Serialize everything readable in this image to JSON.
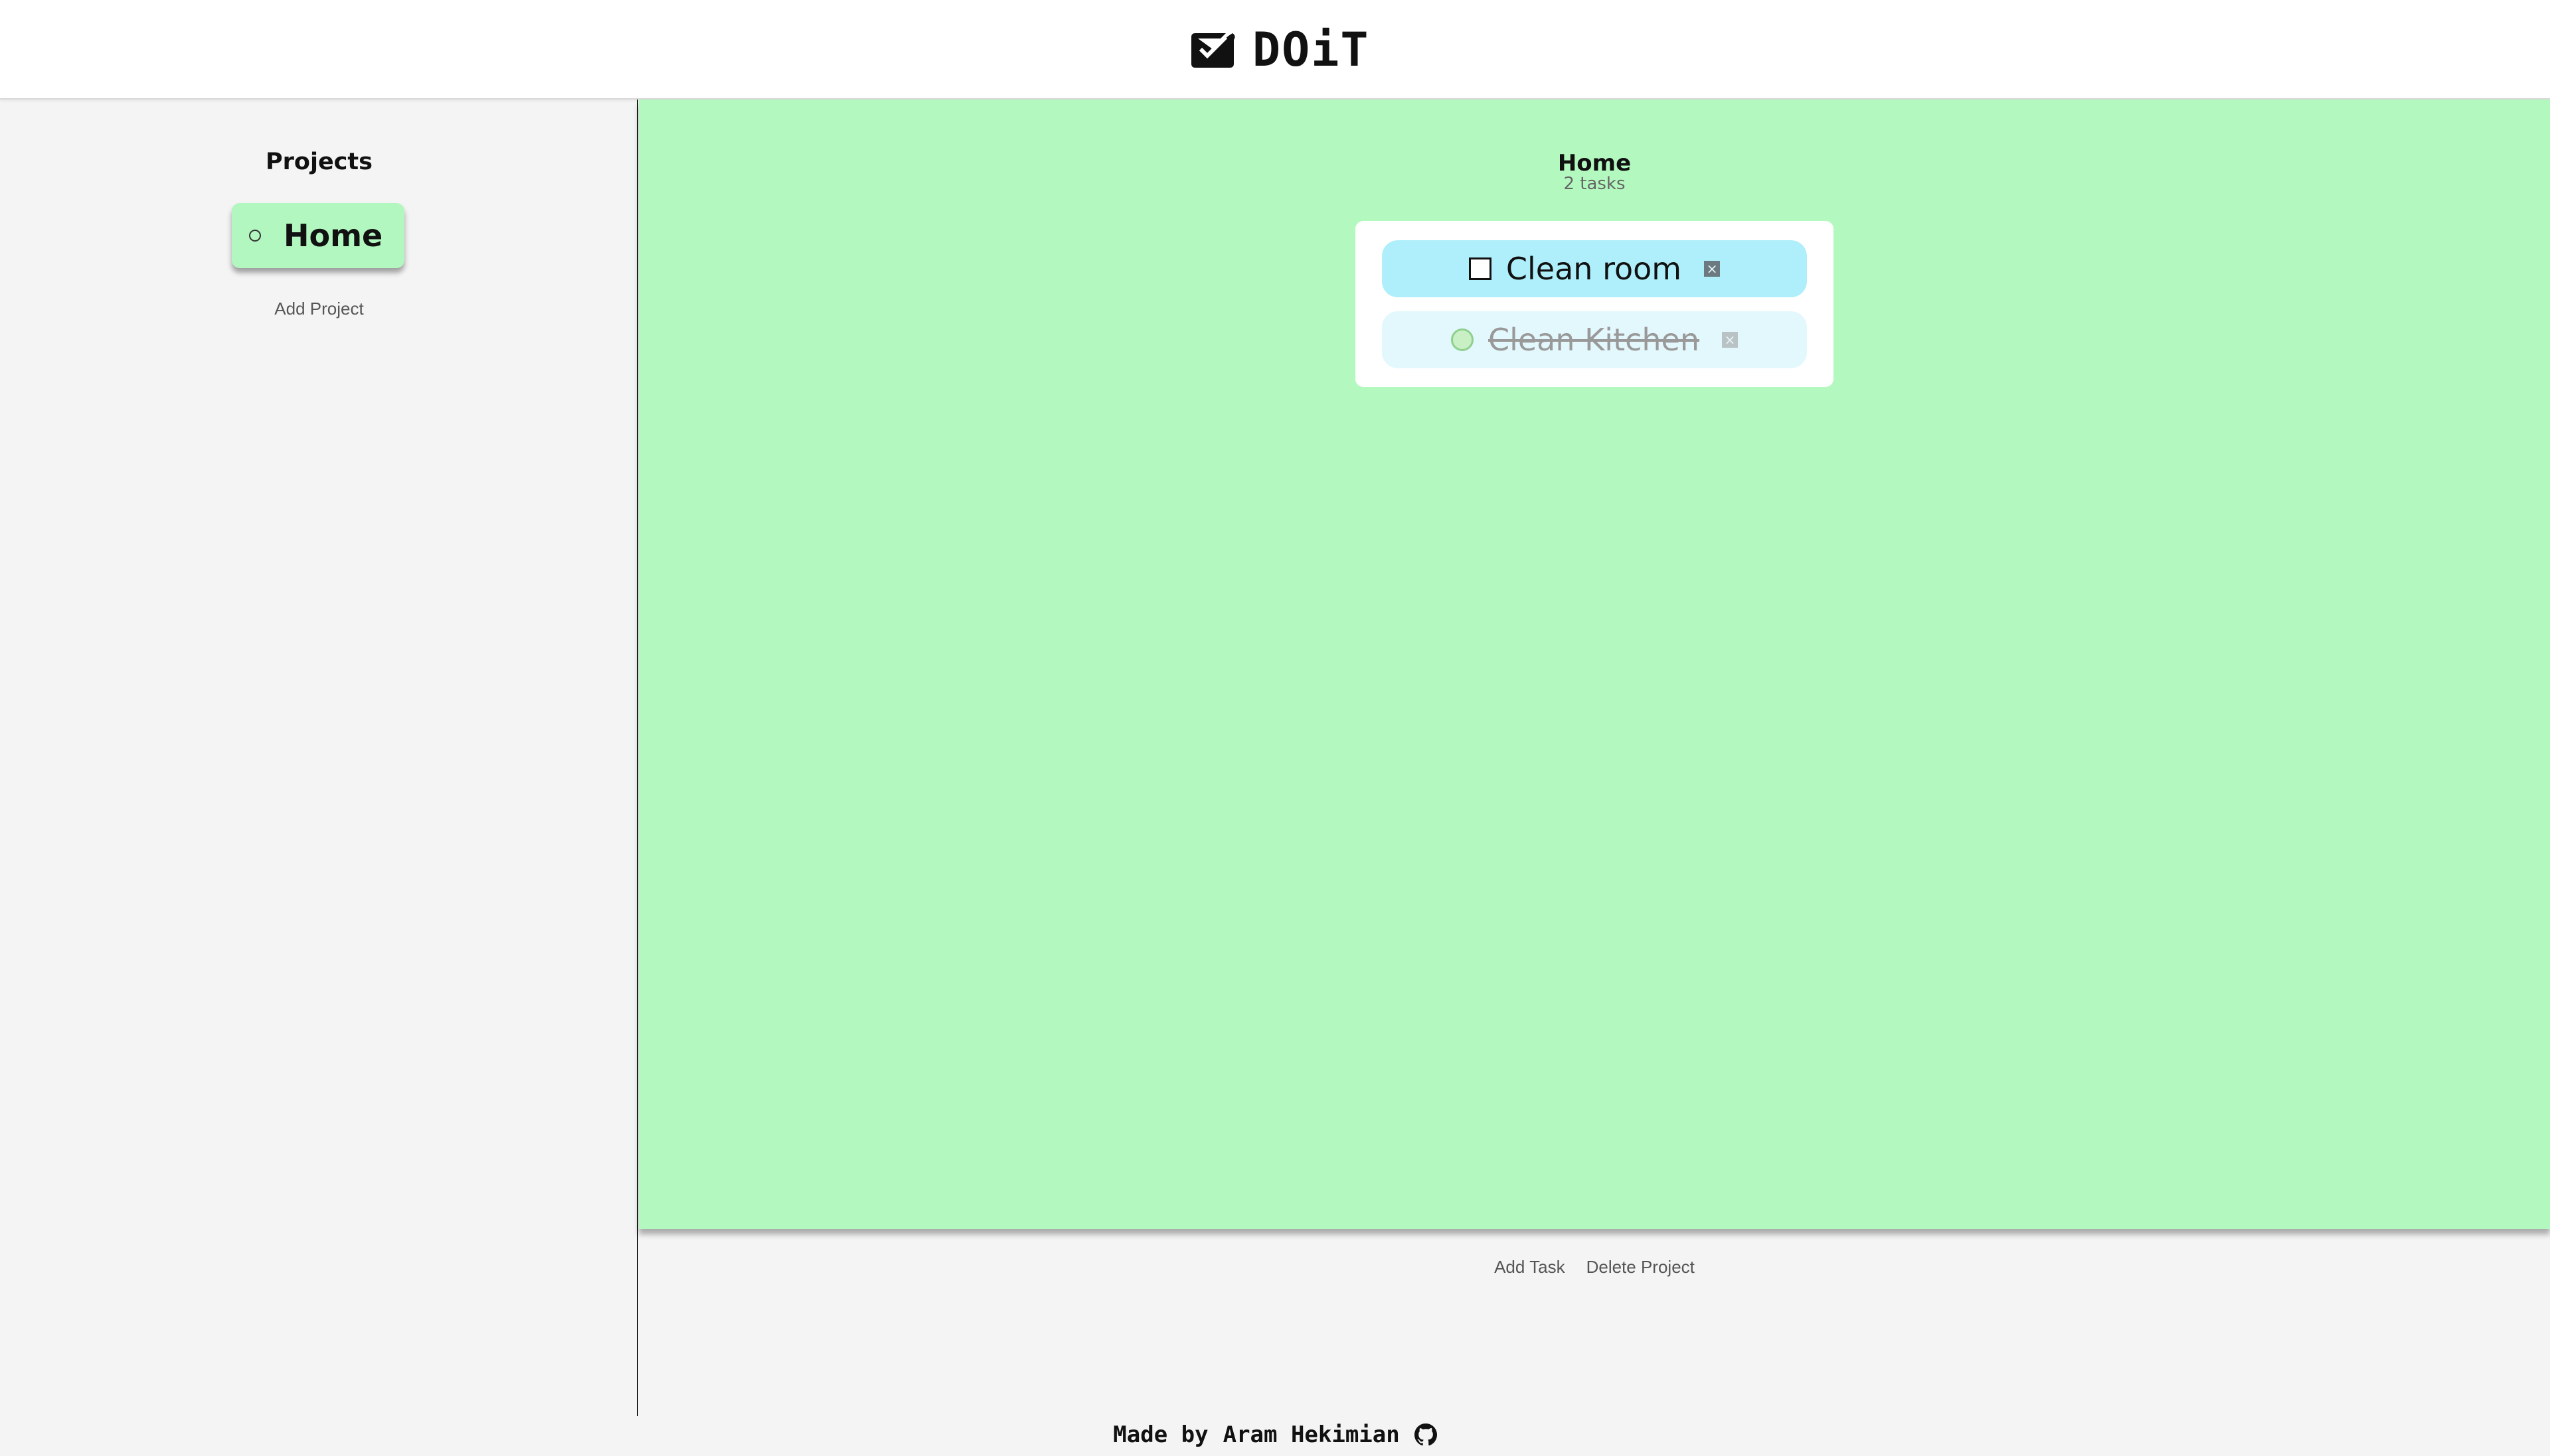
{
  "header": {
    "brand_text": "DOiT",
    "brand_icon": "check-envelope-icon"
  },
  "sidebar": {
    "heading": "Projects",
    "projects": [
      {
        "label": "Home",
        "icon": "circle-icon",
        "active": true
      }
    ],
    "add_project_label": "Add Project"
  },
  "main": {
    "project_title": "Home",
    "task_count": "2 tasks",
    "background_color": "#b3f9bf",
    "tasks": [
      {
        "label": "Clean room",
        "completed": false,
        "color": "#aeeffb"
      },
      {
        "label": "Clean Kitchen",
        "completed": true,
        "color": "#e3f8fd"
      }
    ],
    "add_task_label": "Add Task",
    "delete_project_label": "Delete Project"
  },
  "footer": {
    "made_by_label": "Made by",
    "author": "Aram Hekimian",
    "github_icon": "github-icon"
  }
}
